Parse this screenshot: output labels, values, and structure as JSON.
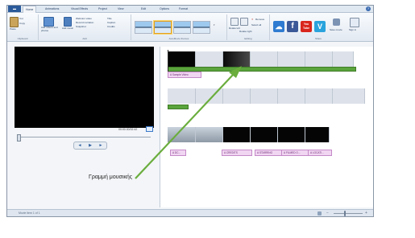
{
  "app": {
    "file_label": ""
  },
  "ribbon": {
    "tabs": [
      "Home",
      "Animations",
      "Visual Effects",
      "Project",
      "View",
      "Edit",
      "Options",
      "Format"
    ],
    "clipboard": {
      "paste": "Paste",
      "cut": "Cut",
      "copy": "Copy",
      "label": "Clipboard"
    },
    "add": {
      "add_videos": "Add videos and photos",
      "add_music": "Add music",
      "webcam_video": "Webcam video",
      "record_narration": "Record narration",
      "snapshot": "Snapshot",
      "title": "Title",
      "caption": "Caption",
      "credits": "Credits",
      "label": "Add"
    },
    "themes_label": "AutoMovie themes",
    "editing": {
      "rotate_left": "Rotate left",
      "rotate_right": "Rotate right",
      "remove": "Remove",
      "select_all": "Select all",
      "label": "Editing"
    },
    "share": {
      "items": [
        "☁",
        "f",
        "You Tube",
        "V"
      ],
      "save_movie": "Save movie",
      "sign_in": "Sign in",
      "label": "Share"
    }
  },
  "preview": {
    "time": "00:00.00/02:42",
    "controls": [
      "◄",
      "▶",
      "►"
    ]
  },
  "timeline": {
    "captions_row1": [
      "A Sample Video"
    ],
    "captions_row3": [
      "A DC...",
      "A CREDITS",
      "A STARRING",
      "A FILMED O...",
      "A LOCATI..."
    ]
  },
  "status": {
    "text": "Movie item 1 of 1"
  },
  "annotation": {
    "text": "Γραμμή μουσικής"
  },
  "colors": {
    "music": "#5aa43c",
    "annotation_arrow": "#6aad3d",
    "caption_bg": "#f1d6f2"
  }
}
